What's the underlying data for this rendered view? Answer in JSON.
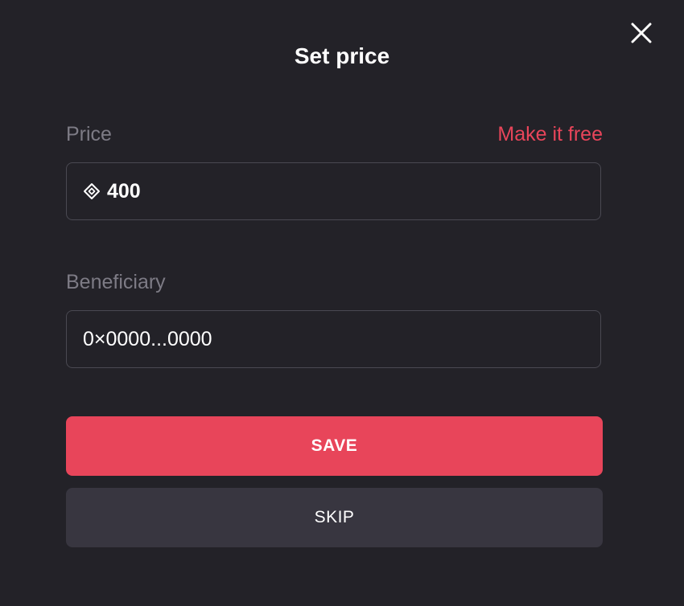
{
  "dialog": {
    "title": "Set price",
    "close_icon": "close-icon"
  },
  "price": {
    "label": "Price",
    "make_free_label": "Make it free",
    "value": "400",
    "currency_icon": "token-diamond-icon"
  },
  "beneficiary": {
    "label": "Beneficiary",
    "value": "0×0000...0000"
  },
  "actions": {
    "save_label": "SAVE",
    "skip_label": "SKIP"
  },
  "colors": {
    "background": "#232228",
    "accent": "#e8455a",
    "secondary_button": "#383640",
    "label": "#7d7b85",
    "input_border": "#4a4952"
  }
}
